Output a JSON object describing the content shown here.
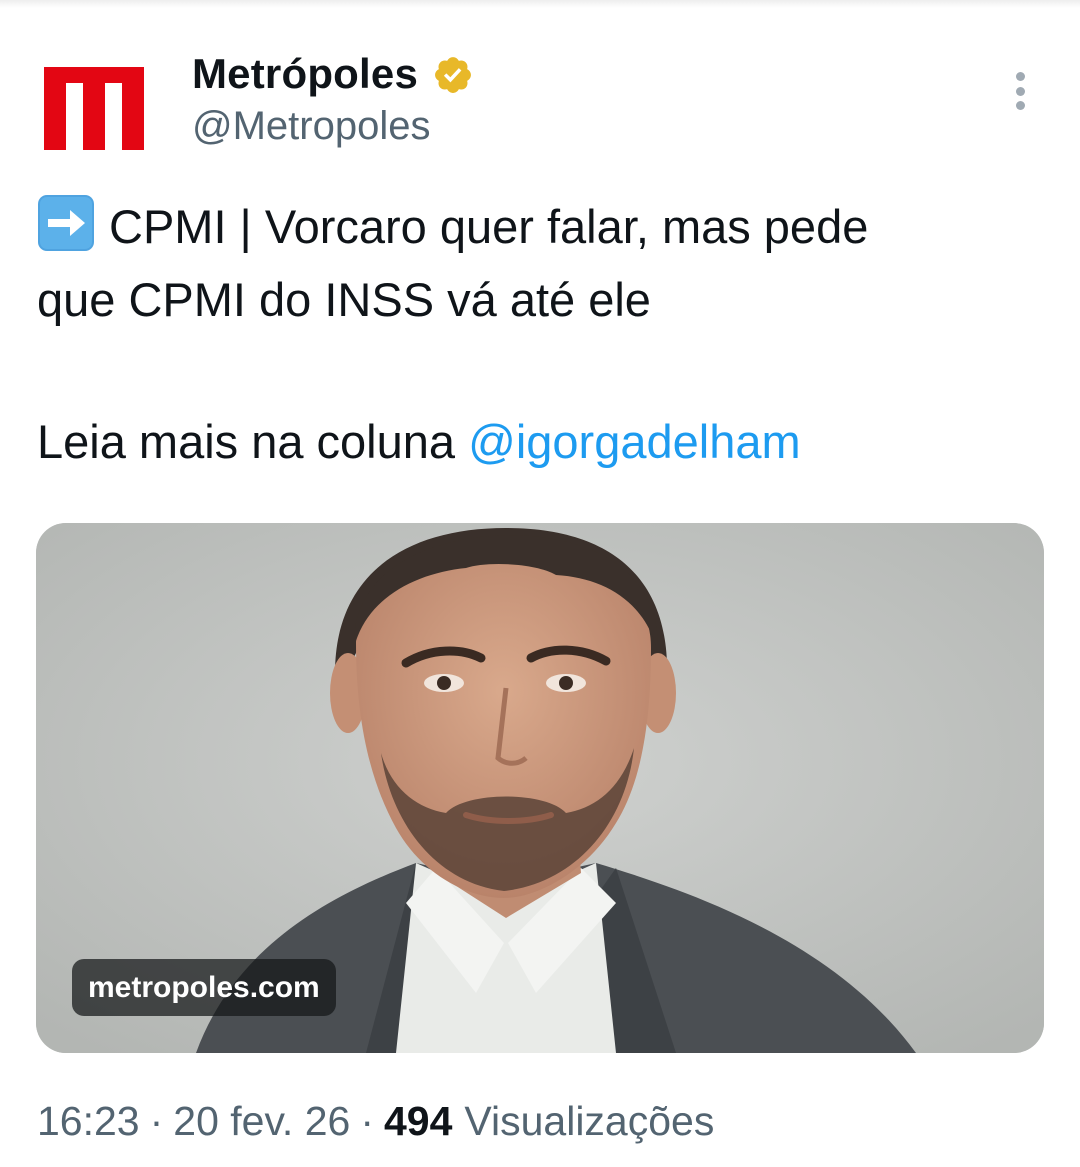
{
  "account": {
    "display_name": "Metrópoles",
    "handle": "@Metropoles",
    "verified": true,
    "avatar_icon": "metropoles-m-logo-icon",
    "brand_color": "#e30613",
    "verified_badge_color": "#e8b829"
  },
  "menu": {
    "icon": "more-vertical-icon"
  },
  "tweet": {
    "emoji": "right-arrow-emoji",
    "line1": "CPMI | Vorcaro quer falar, mas pede",
    "line2": "que CPMI do INSS vá até ele",
    "line3": "Leia mais na coluna ",
    "mention": "@igorgadelham",
    "mention_color": "#1d9bf0"
  },
  "media": {
    "image": "portrait-photo",
    "source_label": "metropoles.com"
  },
  "meta": {
    "time": "16:23",
    "separator": "·",
    "date": "20 fev. 26",
    "views_count": "494",
    "views_label": "Visualizações"
  }
}
